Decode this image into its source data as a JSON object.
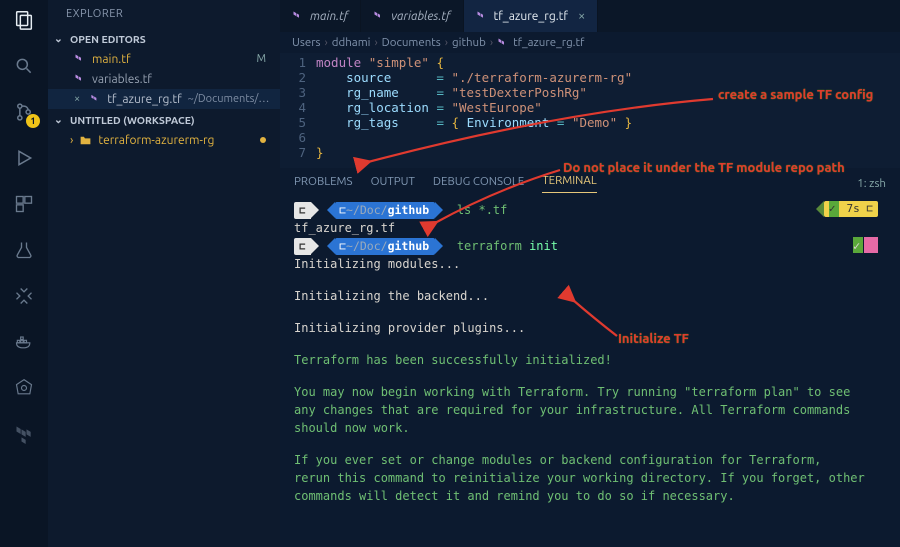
{
  "activity_bar": {
    "badge_count": "1"
  },
  "sidebar": {
    "title": "EXPLORER",
    "open_editors_label": "OPEN EDITORS",
    "workspace_label": "UNTITLED (WORKSPACE)",
    "editors": [
      {
        "name": "main.tf",
        "modified": "M"
      },
      {
        "name": "variables.tf"
      },
      {
        "name": "tf_azure_rg.tf",
        "prefix": "×",
        "hint": "~/Documents/git..."
      }
    ],
    "folder": {
      "name": "terraform-azurerm-rg"
    }
  },
  "tabs": [
    {
      "label": "main.tf"
    },
    {
      "label": "variables.tf"
    },
    {
      "label": "tf_azure_rg.tf"
    }
  ],
  "breadcrumbs": [
    "Users",
    "ddhami",
    "Documents",
    "github",
    "tf_azure_rg.tf"
  ],
  "code_lines": [
    "module \"simple\" {",
    "    source      = \"./terraform-azurerm-rg\"",
    "    rg_name     = \"testDexterPoshRg\"",
    "    rg_location = \"WestEurope\"",
    "    rg_tags     = { Environment = \"Demo\" }",
    "",
    "}"
  ],
  "panel": {
    "tabs": [
      "PROBLEMS",
      "OUTPUT",
      "DEBUG CONSOLE",
      "TERMINAL"
    ],
    "right": "1: zsh"
  },
  "terminal": {
    "prompt_path_dim": "~/Doc/",
    "prompt_path_bold": "github",
    "cmd1": "ls *.tf",
    "out1": "tf_azure_rg.tf",
    "cmd2_a": "terraform",
    "cmd2_b": "init",
    "time_badge": "7s",
    "lines": [
      "Initializing modules...",
      "",
      "Initializing the backend...",
      "",
      "Initializing provider plugins...",
      "",
      "Terraform has been successfully initialized!",
      "",
      "You may now begin working with Terraform. Try running \"terraform plan\" to see",
      "any changes that are required for your infrastructure. All Terraform commands",
      "should now work.",
      "",
      "If you ever set or change modules or backend configuration for Terraform,",
      "rerun this command to reinitialize your working directory. If you forget, other",
      "commands will detect it and remind you to do so if necessary."
    ]
  },
  "annotations": {
    "a1": "create a sample TF config",
    "a2": "Do not place it under the TF module repo path",
    "a3": "Initialize TF"
  }
}
